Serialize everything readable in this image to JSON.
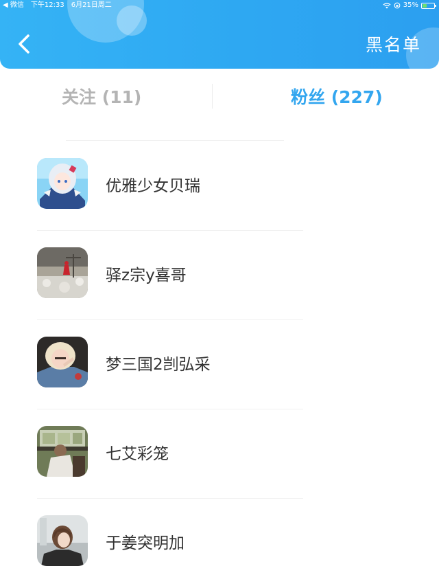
{
  "status_bar": {
    "app": "◀ 微信",
    "time": "下午12:33",
    "date": "6月21日周二",
    "battery": "35%",
    "battery_level": 0.35
  },
  "header": {
    "back_icon": "chevron-left-icon",
    "title": "黑名单"
  },
  "tabs": [
    {
      "label": "关注 (11)",
      "active": false
    },
    {
      "label": "粉丝 (227)",
      "active": true
    }
  ],
  "colors": {
    "header_blue": "#2ea8f2",
    "active_tab": "#33a6ef",
    "inactive_tab": "#b4b4b4",
    "name_text": "#333333"
  },
  "fans": [
    {
      "name": "优雅少女贝瑞",
      "avatar": "anime-girl-avatar"
    },
    {
      "name": "驿z宗y喜哥",
      "avatar": "landscape-red-figure-avatar"
    },
    {
      "name": "梦三国2剀弘采",
      "avatar": "blonde-girl-avatar"
    },
    {
      "name": "七艾彩笼",
      "avatar": "bus-seat-avatar"
    },
    {
      "name": "于姜突明加",
      "avatar": "short-hair-girl-avatar"
    }
  ]
}
